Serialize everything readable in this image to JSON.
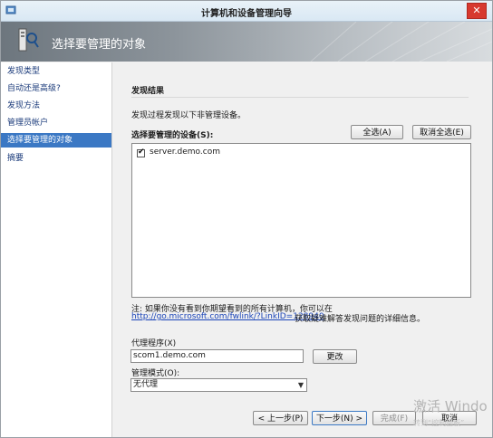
{
  "window": {
    "title": "计算机和设备管理向导",
    "close_glyph": "✕"
  },
  "header": {
    "title": "选择要管理的对象"
  },
  "nav": {
    "items": [
      {
        "label": "发现类型"
      },
      {
        "label": "自动还是高级?"
      },
      {
        "label": "发现方法"
      },
      {
        "label": "管理员帐户"
      },
      {
        "label": "选择要管理的对象",
        "active": true
      },
      {
        "label": "摘要"
      }
    ]
  },
  "main": {
    "section_title": "发现结果",
    "info_text": "发现过程发现以下非管理设备。",
    "list_label": "选择要管理的设备(S):",
    "select_all_label": "全选(A)",
    "deselect_all_label": "取消全选(E)",
    "devices": [
      {
        "name": "server.demo.com",
        "checked": true
      }
    ],
    "note_text": "注: 如果你没有看到你期望看到的所有计算机，你可以在",
    "note_link": "http://go.microsoft.com/fwlink/?LinkID=128940",
    "note_after": "获取疑难解答发现问题的详细信息。",
    "proxy_label": "代理程序(X)",
    "proxy_value": "scom1.demo.com",
    "change_label": "更改",
    "mode_label": "管理模式(O):",
    "mode_value": "无代理"
  },
  "footer": {
    "prev_label": "< 上一步(P)",
    "next_label": "下一步(N) >",
    "finish_label": "完成(F)",
    "cancel_label": "取消"
  },
  "watermark": {
    "text": "激活 Windo",
    "sub": "转到“控制面板”"
  },
  "colors": {
    "nav_active": "#3b78c4",
    "link": "#1a44b8",
    "close": "#d7392f"
  },
  "icons": [
    "app-icon",
    "wizard-icon",
    "close-icon",
    "checkmark-icon",
    "chevron-down-icon"
  ]
}
